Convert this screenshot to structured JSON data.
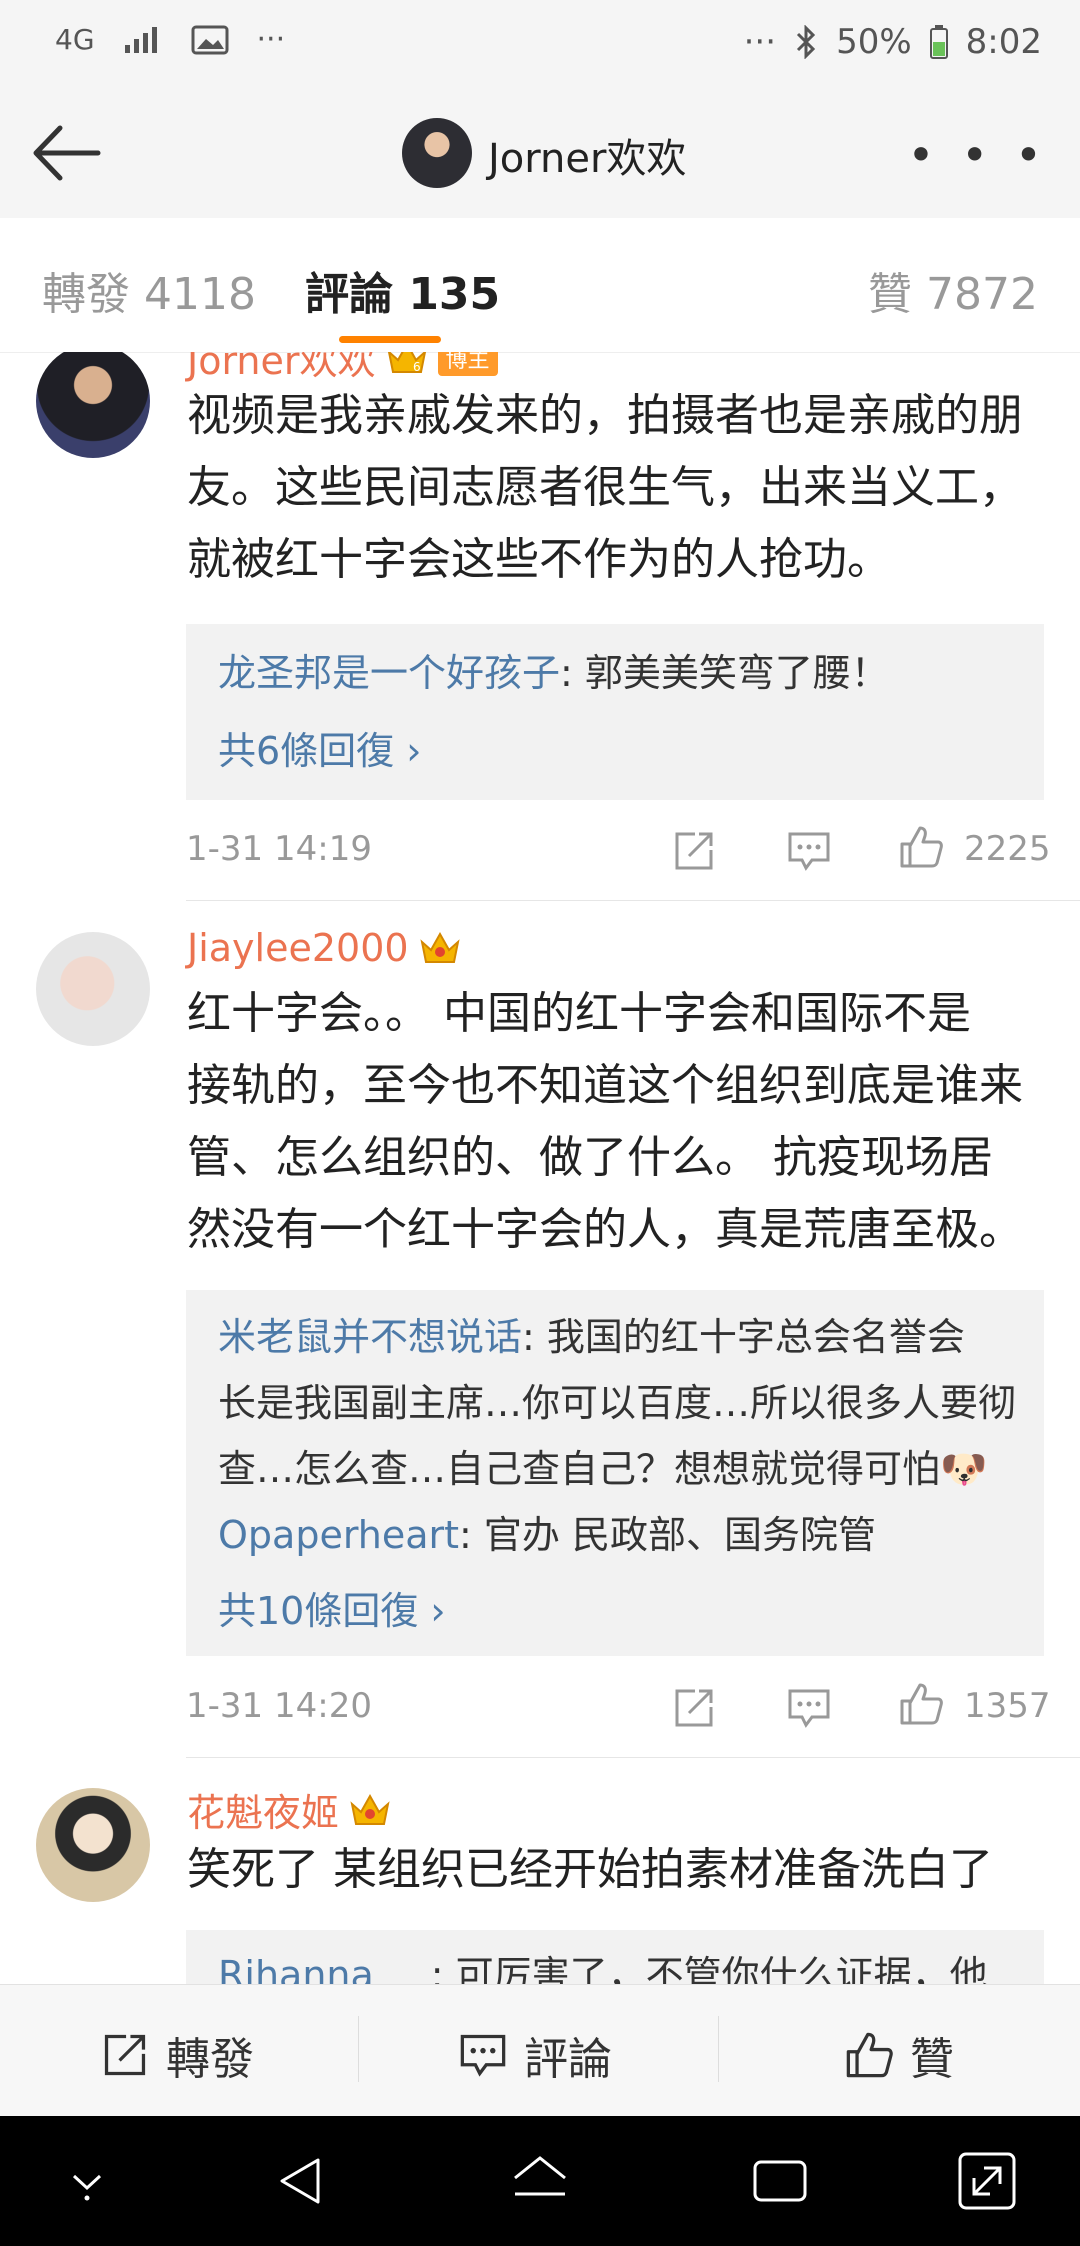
{
  "status_bar": {
    "network": "4G",
    "dots_left": "···",
    "dots_right": "···",
    "battery": "50%",
    "time": "8:02"
  },
  "nav": {
    "title": "Jorner欢欢",
    "more": "• • •"
  },
  "tabs": [
    {
      "label": "轉發 4118"
    },
    {
      "label": "評論 135"
    },
    {
      "label": "贊 7872"
    }
  ],
  "comments": [
    {
      "user": "Jorner欢欢",
      "badge": "博主",
      "lines": [
        "视频是我亲戚发来的，拍摄者也是亲戚的朋",
        "友。这些民间志愿者很生气，出来当义工，",
        "就被红十字会这些不作为的人抢功。"
      ],
      "replies": [
        {
          "user": "龙圣邦是一个好孩子",
          "text": ": 郭美美笑弯了腰！"
        }
      ],
      "more_replies": "共6條回復 ›",
      "time": "1-31 14:19",
      "likes": "2225"
    },
    {
      "user": "Jiaylee2000",
      "lines": [
        "红十字会。。 中国的红十字会和国际不是",
        "接轨的，至今也不知道这个组织到底是谁来",
        "管、怎么组织的、做了什么。 抗疫现场居",
        "然没有一个红十字会的人，真是荒唐至极。"
      ],
      "replies": [
        {
          "user": "米老鼠并不想说话",
          "text": ": 我国的红十字总会名誉会",
          "line2": "长是我国副主席…你可以百度…所以很多人要彻",
          "line3": "查…怎么查…自己查自己？想想就觉得可怕🐶"
        },
        {
          "user": "Opaperheart",
          "text": ": 官办 民政部、国务院管"
        }
      ],
      "more_replies": "共10條回復 ›",
      "time": "1-31 14:20",
      "likes": "1357"
    },
    {
      "user": "花魁夜姬",
      "lines": [
        "笑死了 某组织已经开始拍素材准备洗白了"
      ],
      "replies": [
        {
          "user": "Rihanna___",
          "text": ": 可厉害了，不管你什么证据，他"
        }
      ]
    }
  ],
  "bottom_bar": {
    "repost": "轉發",
    "comment": "評論",
    "like": "贊"
  },
  "colors": {
    "accent": "#ff8200",
    "username": "#eb7350",
    "reply_user": "#4d7aa8"
  }
}
